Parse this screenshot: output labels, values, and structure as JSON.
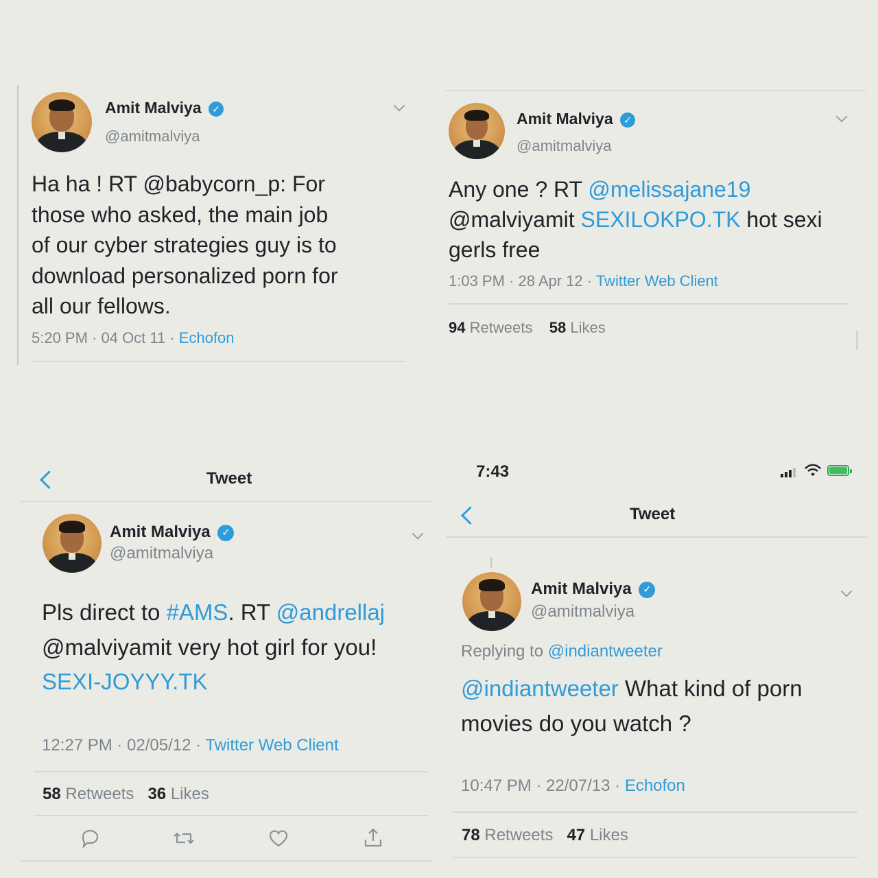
{
  "accent_color": "#2f9bd8",
  "tweets": [
    {
      "name": "Amit Malviya",
      "handle": "@amitmalviya",
      "text_a": "Ha ha ! RT @babycorn_p: For",
      "text_b": "those who asked, the main job",
      "text_c": "of our cyber strategies guy is to",
      "text_d": "download personalized porn for",
      "text_e": "all our fellows.",
      "meta_time": "5:20 PM · 04 Oct 11 · ",
      "meta_source": "Echofon"
    },
    {
      "name": "Amit Malviya",
      "handle": "@amitmalviya",
      "text_pre": "Any one ? RT ",
      "mention1": "@melissajane19",
      "mention2": "@malviyamit",
      "space": " ",
      "link": "SEXILOKPO.TK",
      "text_post": " hot sexi",
      "text_line3": "gerls free",
      "meta_time": "1:03 PM · 28 Apr 12 · ",
      "meta_source": "Twitter Web Client",
      "retweets_count": "94",
      "retweets_label": "Retweets",
      "likes_count": "58",
      "likes_label": "Likes"
    },
    {
      "nav_title": "Tweet",
      "name": "Amit Malviya",
      "handle": "@amitmalviya",
      "text_pre": "Pls direct to ",
      "hashtag": "#AMS",
      "text_mid": ". RT ",
      "mention1": "@andrellaj",
      "text_line2": "@malviyamit very hot girl for you!",
      "link": "SEXI-JOYYY.TK",
      "meta_time": "12:27 PM · 02/05/12 · ",
      "meta_source": "Twitter Web Client",
      "retweets_count": "58",
      "retweets_label": "Retweets",
      "likes_count": "36",
      "likes_label": "Likes",
      "actions": [
        "reply-icon",
        "retweet-icon",
        "like-icon",
        "share-icon"
      ]
    },
    {
      "status_time": "7:43",
      "nav_title": "Tweet",
      "name": "Amit Malviya",
      "handle": "@amitmalviya",
      "replying_label": "Replying to ",
      "replying_handle": "@indiantweeter",
      "mention1": "@indiantweeter",
      "text_line1": " What kind of porn",
      "text_line2": "movies do you watch ?",
      "meta_time": "10:47 PM · 22/07/13 · ",
      "meta_source": "Echofon",
      "retweets_count": "78",
      "retweets_label": "Retweets",
      "likes_count": "47",
      "likes_label": "Likes"
    }
  ]
}
